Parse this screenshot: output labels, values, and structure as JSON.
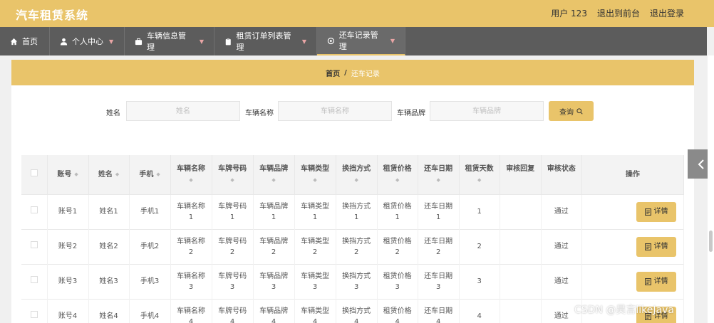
{
  "header": {
    "title": "汽车租赁系统",
    "user_label": "用户 123",
    "back_label": "退出到前台",
    "logout_label": "退出登录"
  },
  "nav": {
    "items": [
      {
        "label": "首页",
        "icon": "home-icon",
        "has_dropdown": false
      },
      {
        "label": "个人中心",
        "icon": "user-icon",
        "has_dropdown": true
      },
      {
        "label": "车辆信息管理",
        "icon": "briefcase-icon",
        "has_dropdown": true
      },
      {
        "label": "租赁订单列表管理",
        "icon": "clipboard-icon",
        "has_dropdown": true
      },
      {
        "label": "还车记录管理",
        "icon": "gear-icon",
        "has_dropdown": true,
        "active": true
      }
    ]
  },
  "breadcrumb": {
    "home": "首页",
    "separator": "/",
    "current": "还车记录"
  },
  "search": {
    "name_label": "姓名",
    "name_placeholder": "姓名",
    "car_name_label": "车辆名称",
    "car_name_placeholder": "车辆名称",
    "brand_label": "车辆品牌",
    "brand_placeholder": "车辆品牌",
    "button_label": "查询"
  },
  "table": {
    "columns": [
      "账号",
      "姓名",
      "手机",
      "车辆名称",
      "车牌号码",
      "车辆品牌",
      "车辆类型",
      "换挡方式",
      "租赁价格",
      "还车日期",
      "租赁天数",
      "审核回复",
      "审核状态",
      "操作"
    ],
    "detail_label": "详情",
    "rows": [
      {
        "account": "账号1",
        "name": "姓名1",
        "phone": "手机1",
        "car_name": "车辆名称1",
        "plate": "车牌号码1",
        "brand": "车辆品牌1",
        "type": "车辆类型1",
        "gear": "换挡方式1",
        "price": "租赁价格1",
        "return_date": "还车日期1",
        "days": "1",
        "reply": "",
        "status": "通过"
      },
      {
        "account": "账号2",
        "name": "姓名2",
        "phone": "手机2",
        "car_name": "车辆名称2",
        "plate": "车牌号码2",
        "brand": "车辆品牌2",
        "type": "车辆类型2",
        "gear": "换挡方式2",
        "price": "租赁价格2",
        "return_date": "还车日期2",
        "days": "2",
        "reply": "",
        "status": "通过"
      },
      {
        "account": "账号3",
        "name": "姓名3",
        "phone": "手机3",
        "car_name": "车辆名称3",
        "plate": "车牌号码3",
        "brand": "车辆品牌3",
        "type": "车辆类型3",
        "gear": "换挡方式3",
        "price": "租赁价格3",
        "return_date": "还车日期3",
        "days": "3",
        "reply": "",
        "status": "通过"
      },
      {
        "account": "账号4",
        "name": "姓名4",
        "phone": "手机4",
        "car_name": "车辆名称4",
        "plate": "车牌号码4",
        "brand": "车辆品牌4",
        "type": "车辆类型4",
        "gear": "换挡方式4",
        "price": "租赁价格4",
        "return_date": "还车日期4",
        "days": "4",
        "reply": "",
        "status": "通过"
      }
    ]
  },
  "watermark": "CSDN @昊言likeJava",
  "colors": {
    "accent": "#e9c46a",
    "nav_bg": "#5c5c5c",
    "page_bg": "#f0f0f0"
  }
}
